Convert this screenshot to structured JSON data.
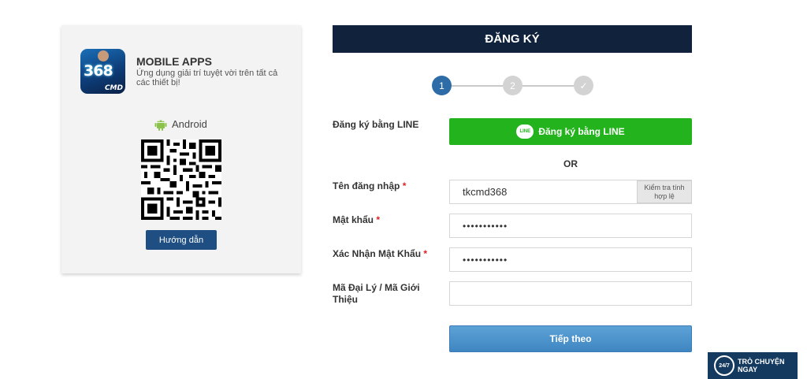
{
  "mobile_apps": {
    "logo_number": "368",
    "logo_brand": "CMD",
    "title": "MOBILE APPS",
    "description": "Ứng dụng giải trí tuyệt vời trên tất cả các thiết bị!",
    "platform_label": "Android",
    "platform_icon": "android-icon",
    "guide_button": "Hướng dẫn"
  },
  "register": {
    "header": "ĐĂNG KÝ",
    "steps": [
      {
        "label": "1",
        "state": "active"
      },
      {
        "label": "2",
        "state": "inactive"
      },
      {
        "label": "✓",
        "state": "inactive"
      }
    ],
    "line_label": "Đăng ký bằng LINE",
    "line_button": "Đăng ký bằng LINE",
    "line_icon_text": "LINE",
    "or_text": "OR",
    "username_label": "Tên đăng nhập",
    "username_value": "tkcmd368",
    "check_button": "Kiểm tra tính hợp lệ",
    "password_label": "Mật khẩu",
    "password_value": "•••••••••••",
    "confirm_label": "Xác Nhận Mật Khẩu",
    "confirm_value": "•••••••••••",
    "referral_label": "Mã Đại Lý / Mã Giới Thiệu",
    "referral_value": "",
    "required_mark": "*",
    "next_button": "Tiếp theo"
  },
  "chat": {
    "badge": "24/7",
    "line1": "TRÒ CHUYỆN",
    "line2": "NGAY"
  },
  "colors": {
    "header_bg": "#10223c",
    "line_green": "#23b31d",
    "step_active": "#2e6ca8",
    "guide_button": "#1f4f82",
    "chat_bg": "#143a5f"
  }
}
